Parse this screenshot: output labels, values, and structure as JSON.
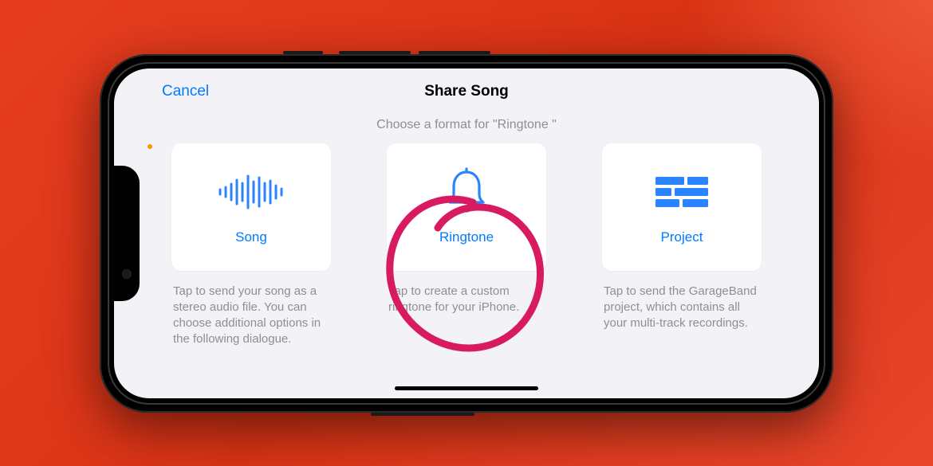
{
  "colors": {
    "accent": "#007aff",
    "background_red": "#e63d1f",
    "annotation": "#d81b60",
    "muted": "#8e8e93"
  },
  "header": {
    "cancel_label": "Cancel",
    "title": "Share Song"
  },
  "subtitle": "Choose a format for \"Ringtone \"",
  "options": [
    {
      "icon": "waveform-icon",
      "label": "Song",
      "description": "Tap to send your song as a stereo audio file. You can choose additional options in the following dialogue."
    },
    {
      "icon": "bell-icon",
      "label": "Ringtone",
      "description": "Tap to create a custom ringtone for your iPhone."
    },
    {
      "icon": "project-tracks-icon",
      "label": "Project",
      "description": "Tap to send the GarageBand project, which contains all your multi-track recordings."
    }
  ],
  "annotation": {
    "highlighted_option": "Ringtone"
  }
}
